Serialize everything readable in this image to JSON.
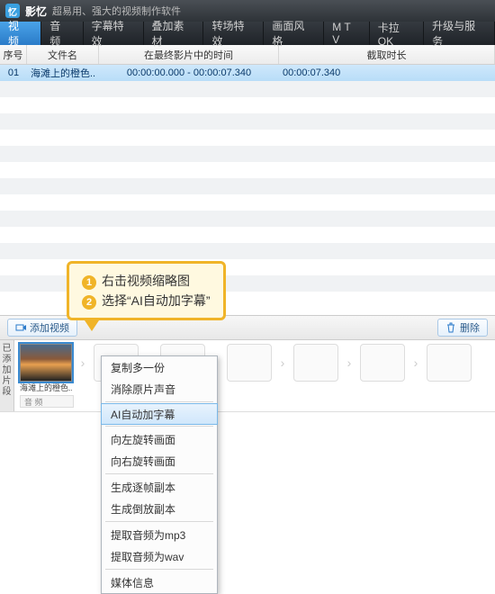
{
  "titlebar": {
    "app": "影忆",
    "sub": "超易用、强大的视频制作软件"
  },
  "tabs": [
    "视 频",
    "音 频",
    "字幕特效",
    "叠加素材",
    "转场特效",
    "画面风格",
    "M T V",
    "卡拉OK",
    "升级与服务"
  ],
  "active_tab": 0,
  "list": {
    "headers": [
      "序号",
      "文件名",
      "在最终影片中的时间",
      "截取时长"
    ],
    "rows": [
      {
        "idx": "01",
        "name": "海滩上的橙色..",
        "range": "00:00:00.000 - 00:00:07.340",
        "dur": "00:00:07.340"
      }
    ]
  },
  "toolbar": {
    "add": "添加视频",
    "delete": "删除"
  },
  "strip": {
    "label": "已添加片段",
    "thumb_caption": "海滩上的橙色..",
    "audio": "音 频",
    "placeholders": 6
  },
  "callout": {
    "l1": "右击视频缩略图",
    "l2": "选择“AI自动加字幕”"
  },
  "ctx": {
    "items": [
      "复制多一份",
      "消除原片声音",
      "AI自动加字幕",
      "向左旋转画面",
      "向右旋转画面",
      "生成逐帧副本",
      "生成倒放副本",
      "提取音频为mp3",
      "提取音频为wav",
      "媒体信息"
    ],
    "highlight": 2,
    "seps": [
      1,
      2,
      4,
      6,
      8
    ]
  }
}
